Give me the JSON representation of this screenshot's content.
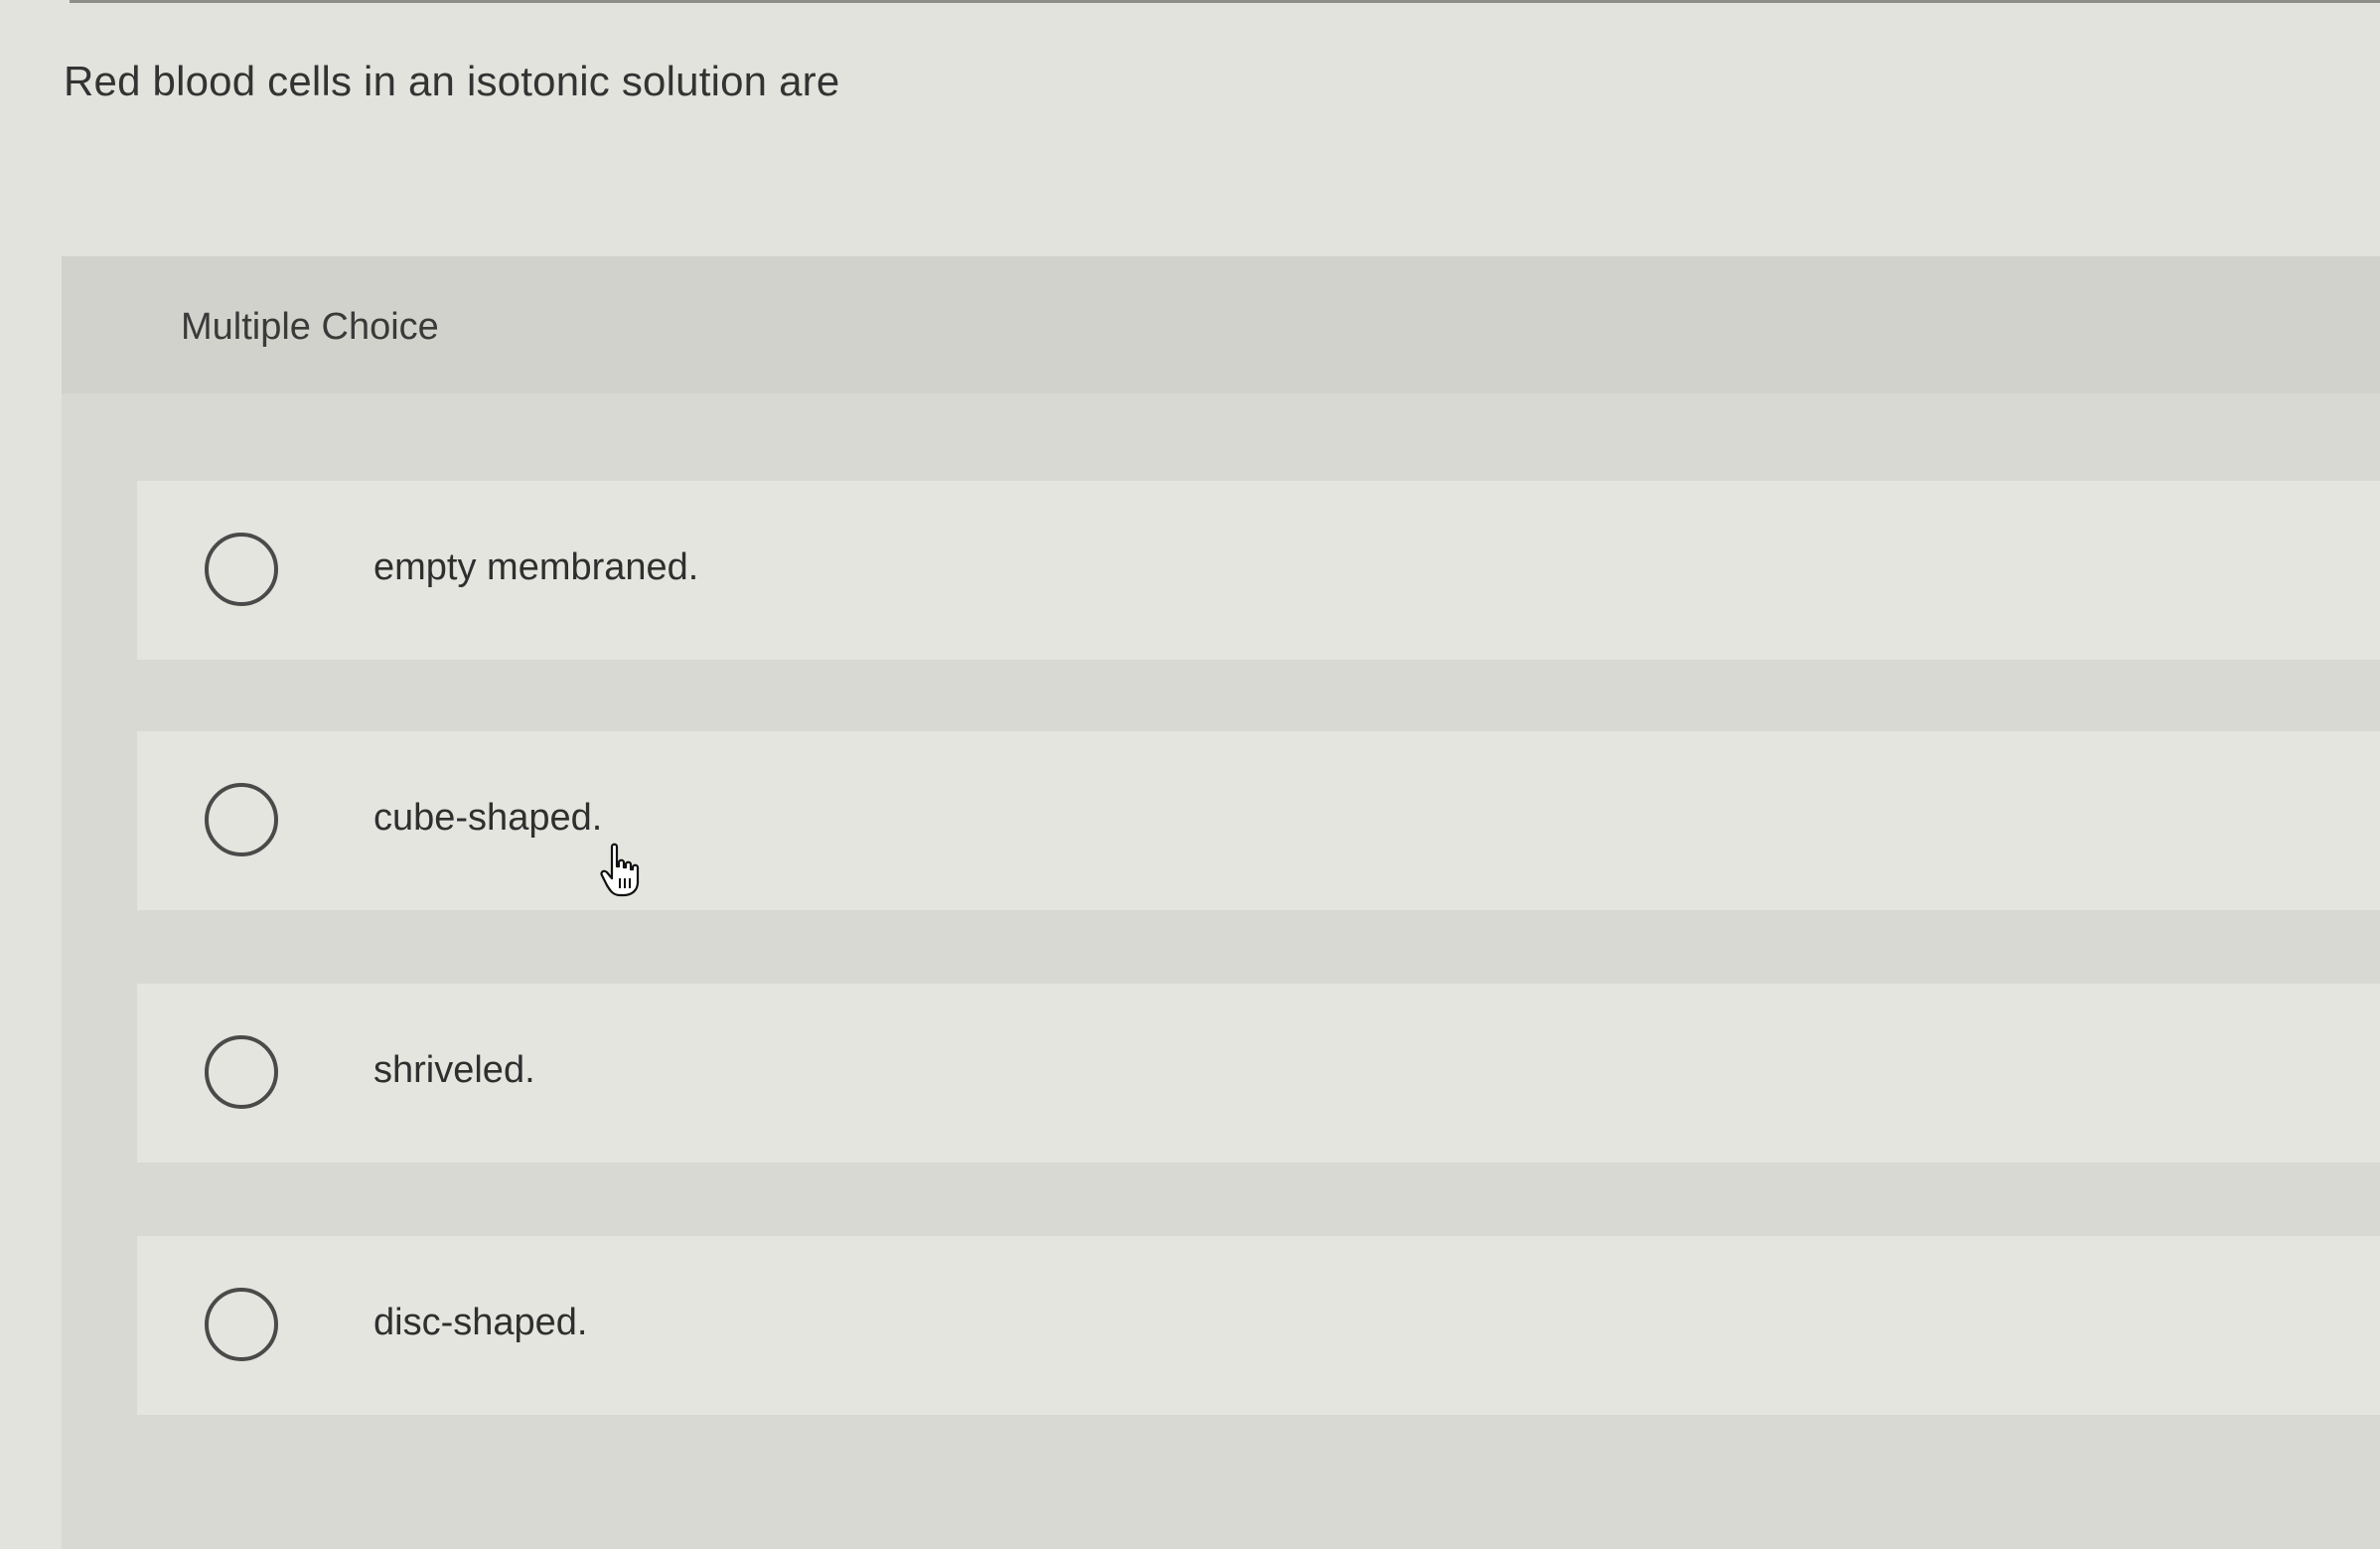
{
  "question": {
    "text": "Red blood cells in an isotonic solution are"
  },
  "choice_panel": {
    "label": "Multiple Choice"
  },
  "options": [
    {
      "label": "empty membraned.",
      "selected": false
    },
    {
      "label": "cube-shaped.",
      "selected": false
    },
    {
      "label": "shriveled.",
      "selected": false
    },
    {
      "label": "disc-shaped.",
      "selected": false
    }
  ],
  "cursor": {
    "icon": "hand-pointer-icon"
  }
}
